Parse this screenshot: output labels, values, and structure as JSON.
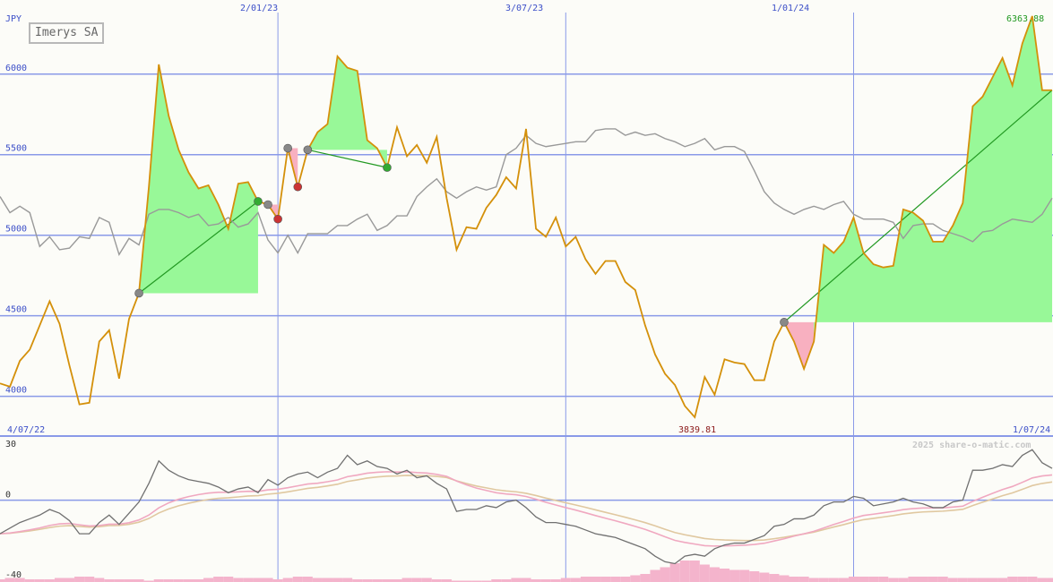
{
  "chart_data": [
    {
      "type": "line",
      "title": "Imerys SA",
      "currency": "JPY",
      "y_ticks": [
        4000,
        4500,
        5000,
        5500,
        6000
      ],
      "ylim": [
        3770,
        6460
      ],
      "x_start_label": "4/07/22",
      "x_end_label": "1/07/24",
      "x_date_labels": [
        "2/01/23",
        "3/07/23",
        "1/01/24"
      ],
      "max_label": "6363.88",
      "min_label": "3839.81",
      "colors": {
        "price": "#d4900a",
        "index": "#999999",
        "up_fill": "#98f898",
        "down_fill": "#f8b0c0",
        "trend": "#229922",
        "grid": "#8a9ae8"
      },
      "series": [
        {
          "role": "price",
          "values": [
            4080,
            4060,
            4220,
            4290,
            4440,
            4590,
            4450,
            4190,
            3950,
            3960,
            4340,
            4410,
            4110,
            4480,
            4640,
            5300,
            6060,
            5740,
            5530,
            5390,
            5290,
            5310,
            5190,
            5040,
            5320,
            5330,
            5210,
            5190,
            5100,
            5540,
            5300,
            5530,
            5640,
            5690,
            6110,
            6040,
            6020,
            5590,
            5540,
            5420,
            5670,
            5490,
            5560,
            5450,
            5610,
            5230,
            4910,
            5050,
            5040,
            5170,
            5250,
            5360,
            5290,
            5660,
            5040,
            4990,
            5110,
            4930,
            4990,
            4850,
            4760,
            4840,
            4840,
            4710,
            4660,
            4440,
            4260,
            4140,
            4070,
            3940,
            3870,
            4120,
            4010,
            4230,
            4210,
            4200,
            4100,
            4100,
            4340,
            4460,
            4340,
            4170,
            4340,
            4940,
            4890,
            4960,
            5110,
            4890,
            4820,
            4800,
            4810,
            5160,
            5140,
            5090,
            4960,
            4960,
            5060,
            5200,
            5800,
            5860,
            5980,
            6100,
            5930,
            6190,
            6360,
            5900,
            5900
          ]
        },
        {
          "role": "index",
          "values": [
            5240,
            5140,
            5180,
            5140,
            4930,
            4990,
            4910,
            4920,
            4990,
            4980,
            5110,
            5080,
            4880,
            4980,
            4940,
            5130,
            5160,
            5160,
            5140,
            5110,
            5130,
            5060,
            5070,
            5110,
            5050,
            5070,
            5140,
            4970,
            4890,
            5000,
            4890,
            5010,
            5010,
            5010,
            5060,
            5060,
            5100,
            5130,
            5030,
            5060,
            5120,
            5120,
            5240,
            5300,
            5350,
            5270,
            5230,
            5270,
            5300,
            5280,
            5300,
            5500,
            5540,
            5620,
            5570,
            5550,
            5560,
            5570,
            5580,
            5580,
            5650,
            5660,
            5660,
            5620,
            5640,
            5620,
            5630,
            5600,
            5580,
            5550,
            5570,
            5600,
            5530,
            5550,
            5550,
            5520,
            5400,
            5270,
            5200,
            5160,
            5130,
            5160,
            5180,
            5160,
            5190,
            5210,
            5130,
            5100,
            5100,
            5100,
            5080,
            4980,
            5060,
            5070,
            5070,
            5030,
            5010,
            4990,
            4960,
            5020,
            5030,
            5070,
            5100,
            5090,
            5080,
            5130,
            5230
          ]
        }
      ]
    },
    {
      "type": "line",
      "y_ticks": [
        30,
        0,
        -40
      ],
      "watermark": "2025 share-o-matic.com",
      "colors": {
        "momentum": "#707070",
        "signal_fast": "#f0a8c0",
        "signal_slow": "#e0c8a0",
        "volume": "#f4b4cc",
        "zero": "#8a9ae8"
      },
      "series": [
        {
          "role": "momentum",
          "values": [
            -18,
            -15,
            -12,
            -10,
            -8,
            -5,
            -7,
            -11,
            -18,
            -18,
            -12,
            -8,
            -13,
            -7,
            -1,
            9,
            21,
            16,
            13,
            11,
            10,
            9,
            7,
            4,
            6,
            7,
            4,
            11,
            8,
            12,
            14,
            15,
            12,
            15,
            17,
            24,
            19,
            21,
            18,
            17,
            14,
            16,
            12,
            13,
            9,
            6,
            -6,
            -5,
            -5,
            -3,
            -4,
            -1,
            0,
            -4,
            -9,
            -12,
            -12,
            -13,
            -14,
            -16,
            -18,
            -19,
            -20,
            -22,
            -24,
            -26,
            -30,
            -33,
            -34,
            -30,
            -29,
            -30,
            -26,
            -24,
            -23,
            -23,
            -21,
            -19,
            -14,
            -13,
            -10,
            -10,
            -8,
            -3,
            -1,
            -1,
            2,
            1,
            -3,
            -2,
            -1,
            1,
            -1,
            -2,
            -4,
            -4,
            -1,
            0,
            16,
            16,
            17,
            19,
            18,
            24,
            27,
            20,
            17
          ]
        }
      ],
      "volume": [
        2,
        3,
        3,
        2,
        2,
        2,
        3,
        3,
        4,
        4,
        3,
        2,
        2,
        2,
        2,
        1,
        2,
        2,
        2,
        2,
        2,
        3,
        4,
        4,
        3,
        3,
        3,
        3,
        2,
        3,
        4,
        4,
        3,
        3,
        3,
        3,
        2,
        2,
        2,
        2,
        2,
        3,
        3,
        3,
        2,
        2,
        1,
        1,
        1,
        1,
        2,
        2,
        3,
        3,
        2,
        2,
        2,
        3,
        3,
        4,
        4,
        4,
        4,
        4,
        5,
        6,
        9,
        11,
        14,
        16,
        16,
        13,
        11,
        10,
        9,
        9,
        8,
        7,
        6,
        5,
        4,
        4,
        3,
        3,
        3,
        3,
        4,
        4,
        4,
        4,
        3,
        3,
        4,
        4,
        4,
        4,
        3,
        3,
        3,
        3,
        3,
        3,
        4,
        4,
        4,
        3,
        3
      ]
    }
  ]
}
